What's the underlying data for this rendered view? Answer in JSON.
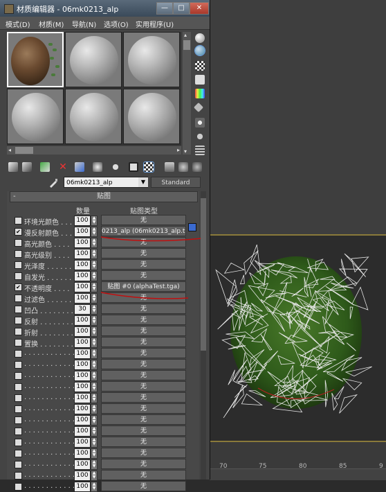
{
  "window": {
    "title": "材质编辑器 - 06mk0213_alp",
    "minimize": "—",
    "maximize": "□",
    "close": "✕"
  },
  "menu": [
    "模式(D)",
    "材质(M)",
    "导航(N)",
    "选项(O)",
    "实用程序(U)"
  ],
  "material": {
    "name": "06mk0213_alp",
    "type": "Standard"
  },
  "rollout": {
    "title": "贴图",
    "collapse_glyph": "-",
    "col_amount": "数量",
    "col_maptype": "贴图类型"
  },
  "maps": [
    {
      "checked": false,
      "label": "环境光颜色 . . .",
      "amount": "100",
      "map": "无"
    },
    {
      "checked": true,
      "label": "漫反射颜色 . . .",
      "amount": "100",
      "map": "0213_alp (06mk0213_alp.tga)"
    },
    {
      "checked": false,
      "label": "高光颜色 . . . .",
      "amount": "100",
      "map": "无"
    },
    {
      "checked": false,
      "label": "高光级别 . . . .",
      "amount": "100",
      "map": "无"
    },
    {
      "checked": false,
      "label": "光泽度 . . . . . .",
      "amount": "100",
      "map": "无"
    },
    {
      "checked": false,
      "label": "自发光 . . . . . .",
      "amount": "100",
      "map": "无"
    },
    {
      "checked": true,
      "label": "不透明度 . . . .",
      "amount": "100",
      "map": "贴图 #0 (alphaTest.tga)"
    },
    {
      "checked": false,
      "label": "过滤色 . . . . . .",
      "amount": "100",
      "map": "无"
    },
    {
      "checked": false,
      "label": "凹凸 . . . . . . . .",
      "amount": "30",
      "map": "无"
    },
    {
      "checked": false,
      "label": "反射 . . . . . . . .",
      "amount": "100",
      "map": "无"
    },
    {
      "checked": false,
      "label": "折射 . . . . . . . .",
      "amount": "100",
      "map": "无"
    },
    {
      "checked": false,
      "label": "置换 . . . . . . . .",
      "amount": "100",
      "map": "无"
    },
    {
      "checked": false,
      "label": ". . . . . . . . . . . .",
      "amount": "100",
      "map": "无"
    },
    {
      "checked": false,
      "label": ". . . . . . . . . . . .",
      "amount": "100",
      "map": "无"
    },
    {
      "checked": false,
      "label": ". . . . . . . . . . . .",
      "amount": "100",
      "map": "无"
    },
    {
      "checked": false,
      "label": ". . . . . . . . . . . .",
      "amount": "100",
      "map": "无"
    },
    {
      "checked": false,
      "label": ". . . . . . . . . . . .",
      "amount": "100",
      "map": "无"
    },
    {
      "checked": false,
      "label": ". . . . . . . . . . . .",
      "amount": "100",
      "map": "无"
    },
    {
      "checked": false,
      "label": ". . . . . . . . . . . .",
      "amount": "100",
      "map": "无"
    },
    {
      "checked": false,
      "label": ". . . . . . . . . . . .",
      "amount": "100",
      "map": "无"
    },
    {
      "checked": false,
      "label": ". . . . . . . . . . . .",
      "amount": "100",
      "map": "无"
    },
    {
      "checked": false,
      "label": ". . . . . . . . . . . .",
      "amount": "100",
      "map": "无"
    },
    {
      "checked": false,
      "label": ". . . . . . . . . . . .",
      "amount": "100",
      "map": "无"
    },
    {
      "checked": false,
      "label": ". . . . . . . . . . . .",
      "amount": "100",
      "map": "无"
    },
    {
      "checked": false,
      "label": ". . . . . . . . . . . .",
      "amount": "100",
      "map": "无"
    }
  ],
  "ruler": {
    "ticks": [
      "70",
      "75",
      "80",
      "85",
      "9"
    ]
  },
  "icons": {
    "side": [
      "sample-type-icon",
      "backlight-icon",
      "background-icon",
      "uv-tiling-icon",
      "video-color-check-icon",
      "make-preview-icon",
      "options-icon",
      "select-by-material-icon",
      "material-map-navigator-icon"
    ],
    "toolbar": [
      "get-material-icon",
      "put-to-scene-icon",
      "assign-to-selection-icon",
      "reset-map-icon",
      "make-unique-icon",
      "put-to-library-icon",
      "material-id-icon",
      "show-map-icon",
      "show-end-result-icon",
      "go-to-parent-icon",
      "go-forward-icon"
    ]
  },
  "colors": {
    "annotation": "#c01010",
    "highlight": "#3a6ad0"
  }
}
